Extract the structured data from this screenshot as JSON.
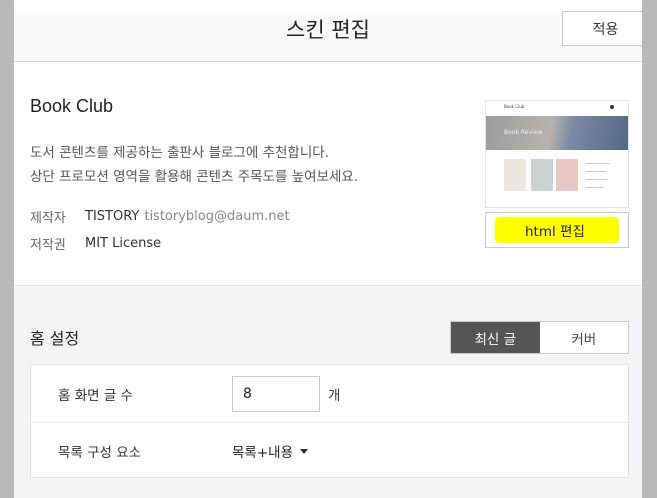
{
  "header": {
    "title": "스킨 편집",
    "apply_label": "적용"
  },
  "skin": {
    "name": "Book Club",
    "desc_line1": "도서 콘텐츠를 제공하는 출판사 블로그에 추천합니다.",
    "desc_line2": "상단 프로모션 영역을 활용해 콘텐츠 주목도를 높여보세요.",
    "author_label": "제작자",
    "author_name": "TISTORY",
    "author_email": "tistoryblog@daum.net",
    "license_label": "저작권",
    "license_value": "MIT License"
  },
  "thumbnail": {
    "brand": "Book Club",
    "hero_text": "Book Review"
  },
  "edit_html_label": "html 편집",
  "home": {
    "title": "홈 설정",
    "tabs": [
      {
        "label": "최신 글",
        "active": true
      },
      {
        "label": "커버",
        "active": false
      }
    ],
    "rows": [
      {
        "label": "홈 화면 글 수",
        "value": "8",
        "unit": "개"
      },
      {
        "label": "목록 구성 요소",
        "value": "목록+내용"
      }
    ]
  },
  "colors": {
    "highlight": "#ffff00",
    "active_tab": "#555555"
  }
}
